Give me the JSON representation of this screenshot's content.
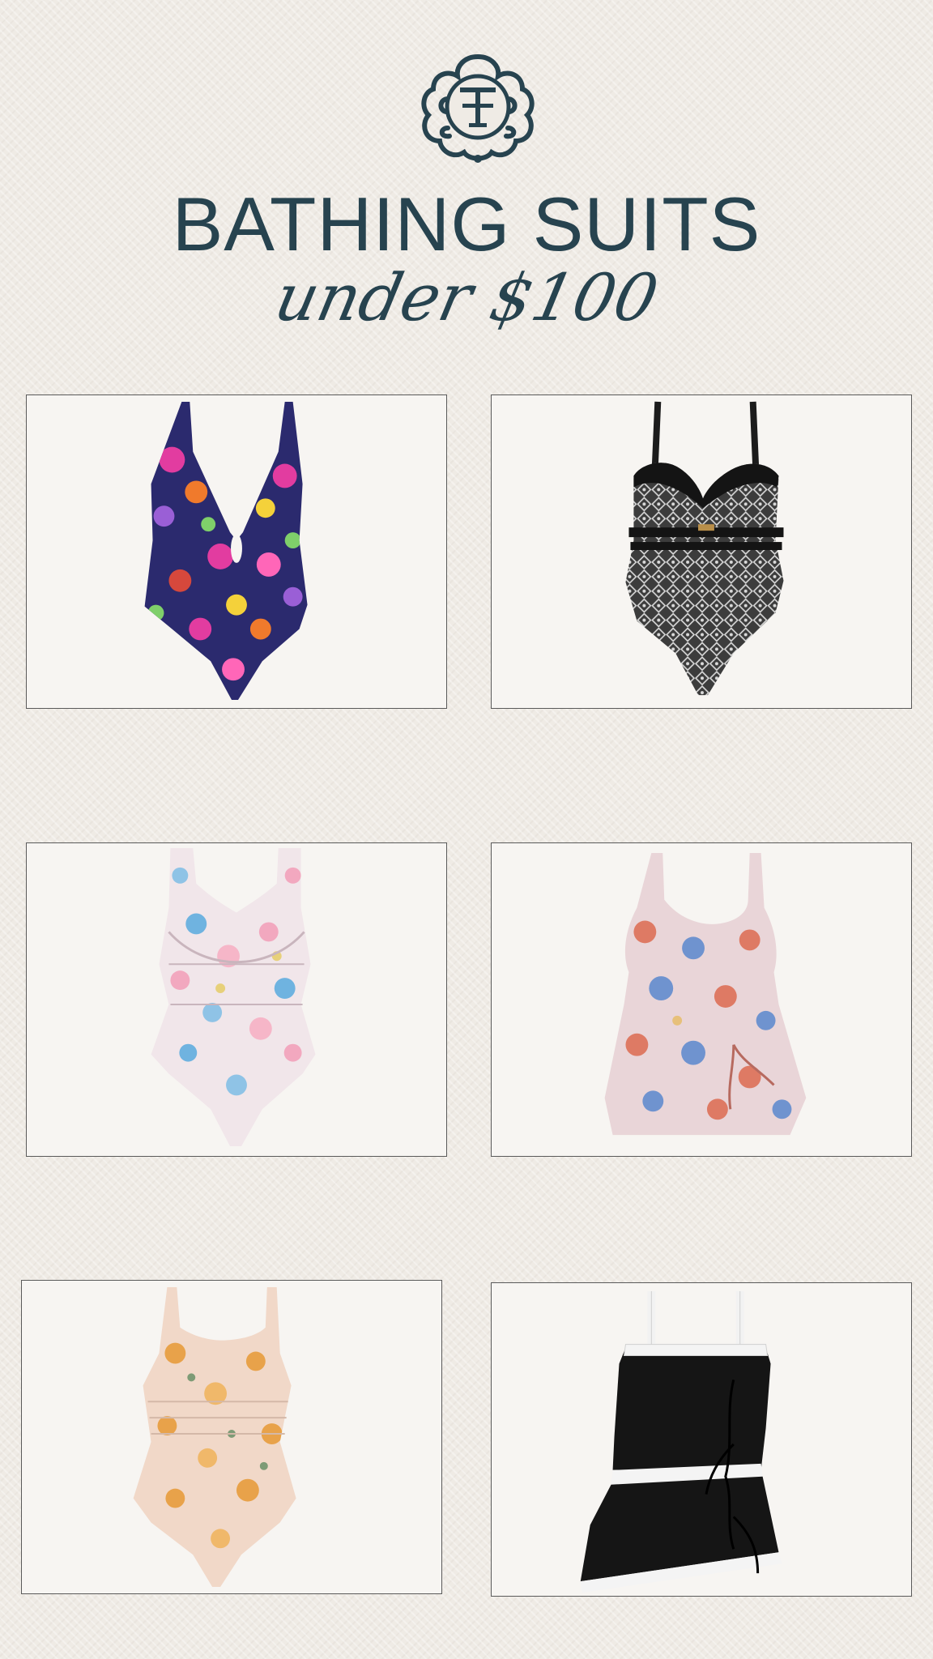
{
  "header": {
    "title": "BATHING SUITS",
    "subtitle": "under $100"
  },
  "colors": {
    "brand": "#27434f",
    "background": "#efebe5",
    "card": "#f7f5f2"
  },
  "products": [
    {
      "name": "swimsuit-floral-plunge"
    },
    {
      "name": "swimsuit-black-geometric"
    },
    {
      "name": "swimsuit-blue-pink-floral-twist"
    },
    {
      "name": "swimdress-floral-side-tie"
    },
    {
      "name": "swimsuit-peach-floral-ruched"
    },
    {
      "name": "swimdress-black-white-trim"
    }
  ]
}
